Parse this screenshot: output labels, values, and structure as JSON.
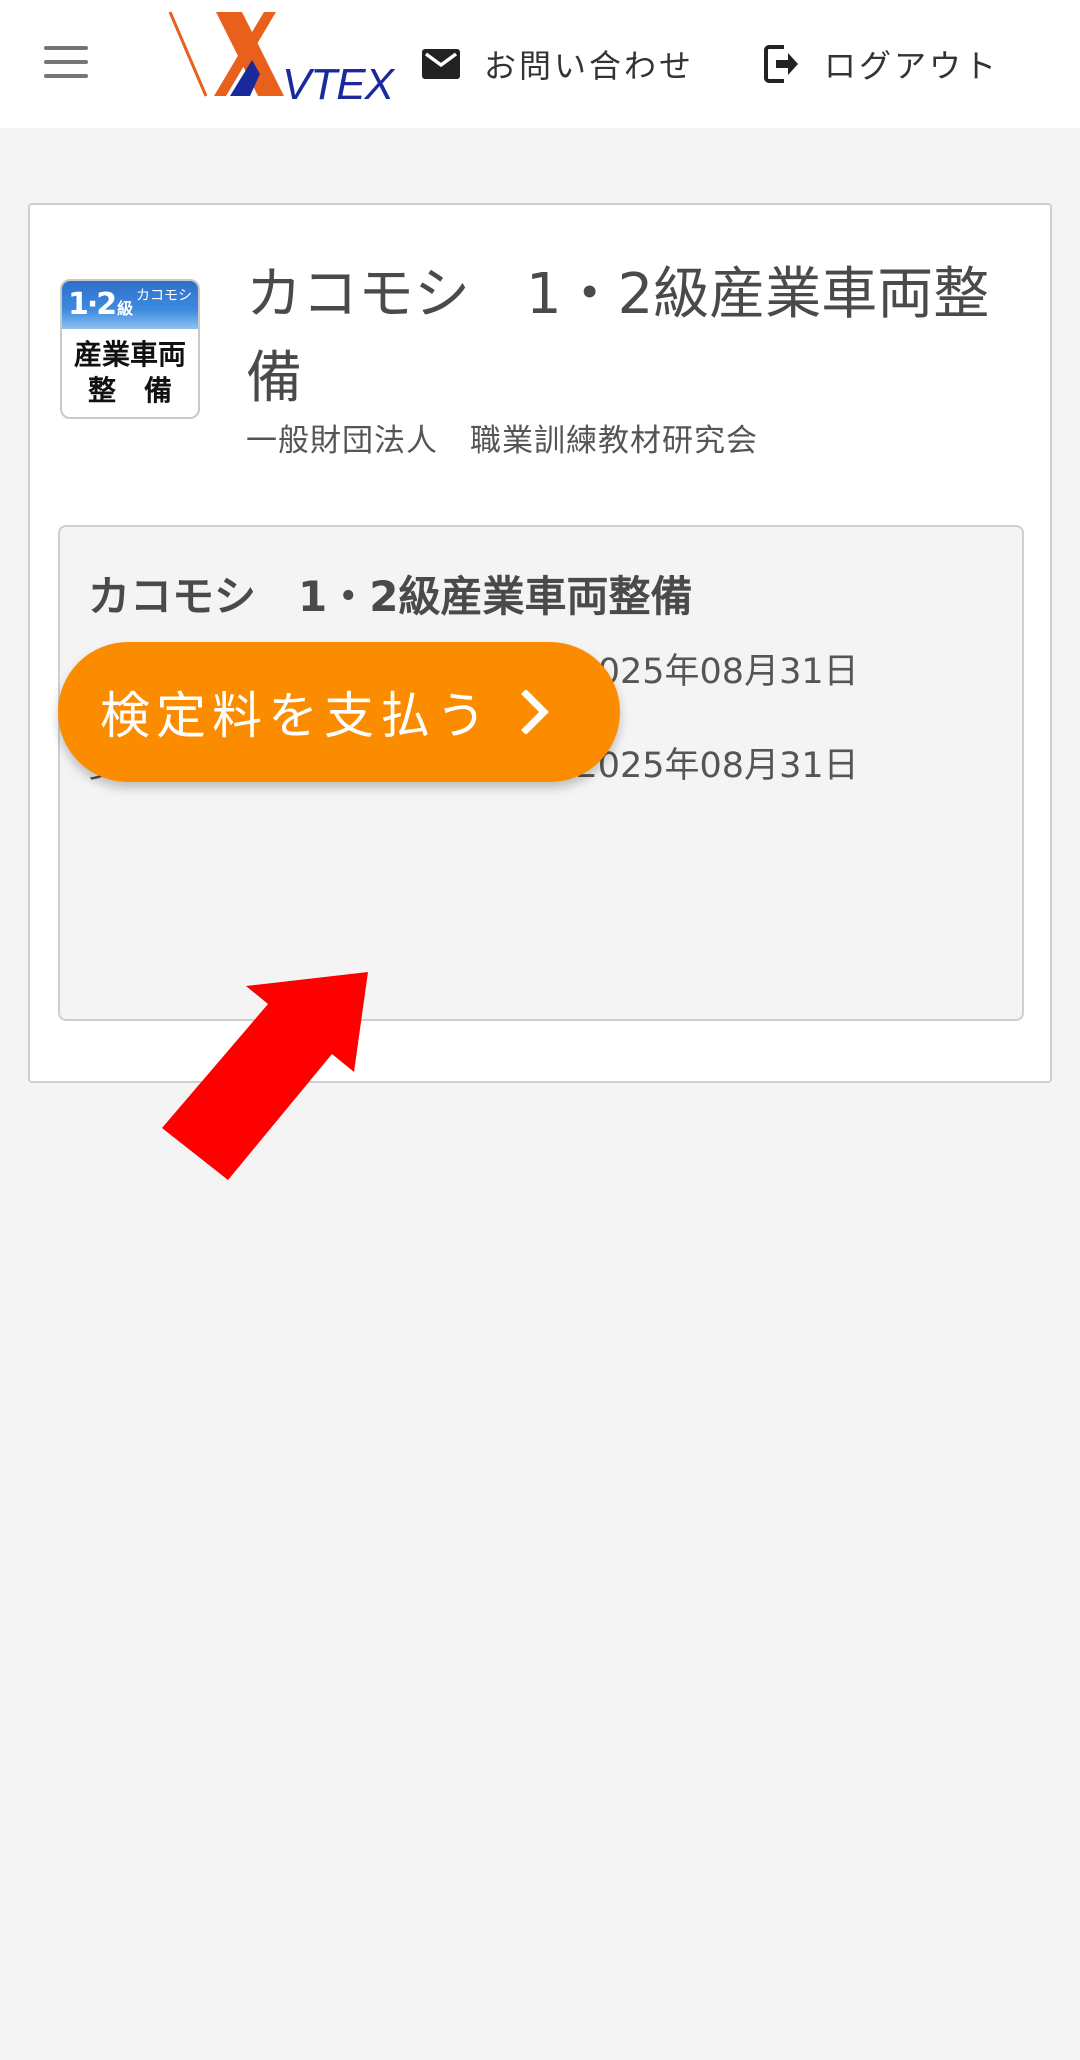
{
  "header": {
    "logo_text": "VTEX",
    "contact_label": "お問い合わせ",
    "logout_label": "ログアウト"
  },
  "course": {
    "thumb_grade": "1·2",
    "thumb_grade_suffix": "級",
    "thumb_brand": "カコモシ",
    "thumb_line1": "産業車両",
    "thumb_line2": "整　備",
    "title": "カコモシ　1・2級産業車両整備",
    "organization": "一般財団法人　職業訓練教材研究会"
  },
  "exam": {
    "title": "カコモシ　1・2級産業車両整備",
    "execution_period": "実施期間：2025年04月22日~2025年08月31日",
    "reception_period": "受付期間：2025年04月22日~2025年08月31日",
    "pay_button_label": "検定料を支払う"
  },
  "colors": {
    "accent": "#fb8c00",
    "annotation_arrow": "#ff0000",
    "logo_orange": "#e8601c",
    "logo_navy": "#1a2a9c"
  }
}
